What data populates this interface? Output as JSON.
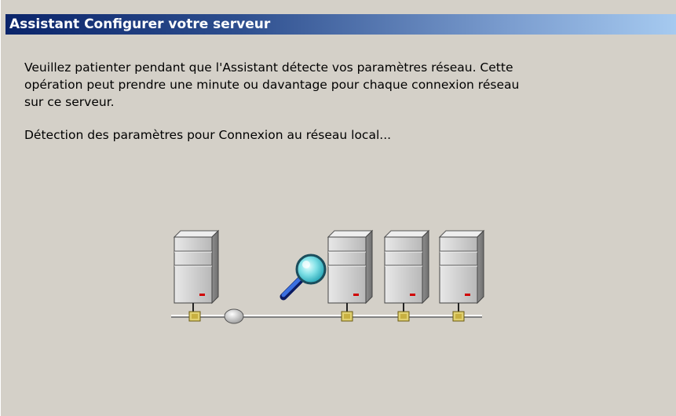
{
  "window": {
    "title": "Assistant Configurer votre serveur"
  },
  "content": {
    "paragraph_lines": [
      "Veuillez patienter pendant que l'Assistant détecte vos paramètres réseau. Cette",
      "opération peut prendre une minute ou davantage pour chaque connexion réseau",
      "sur ce serveur."
    ],
    "status": "Détection des paramètres pour Connexion au réseau local..."
  },
  "illustration": {
    "icons": [
      "server-icon",
      "network-hub-icon",
      "magnifier-icon",
      "server-icon",
      "server-icon",
      "server-icon"
    ],
    "colors": {
      "background": "#d4d0c8",
      "titlebar_start": "#0a246a",
      "titlebar_end": "#a6caf0",
      "server_body": "#c9c9c9",
      "server_led": "#d00000",
      "connector": "#e0d070",
      "magnifier_lens": "#7fe0e6",
      "magnifier_handle": "#1e3fa8"
    }
  }
}
